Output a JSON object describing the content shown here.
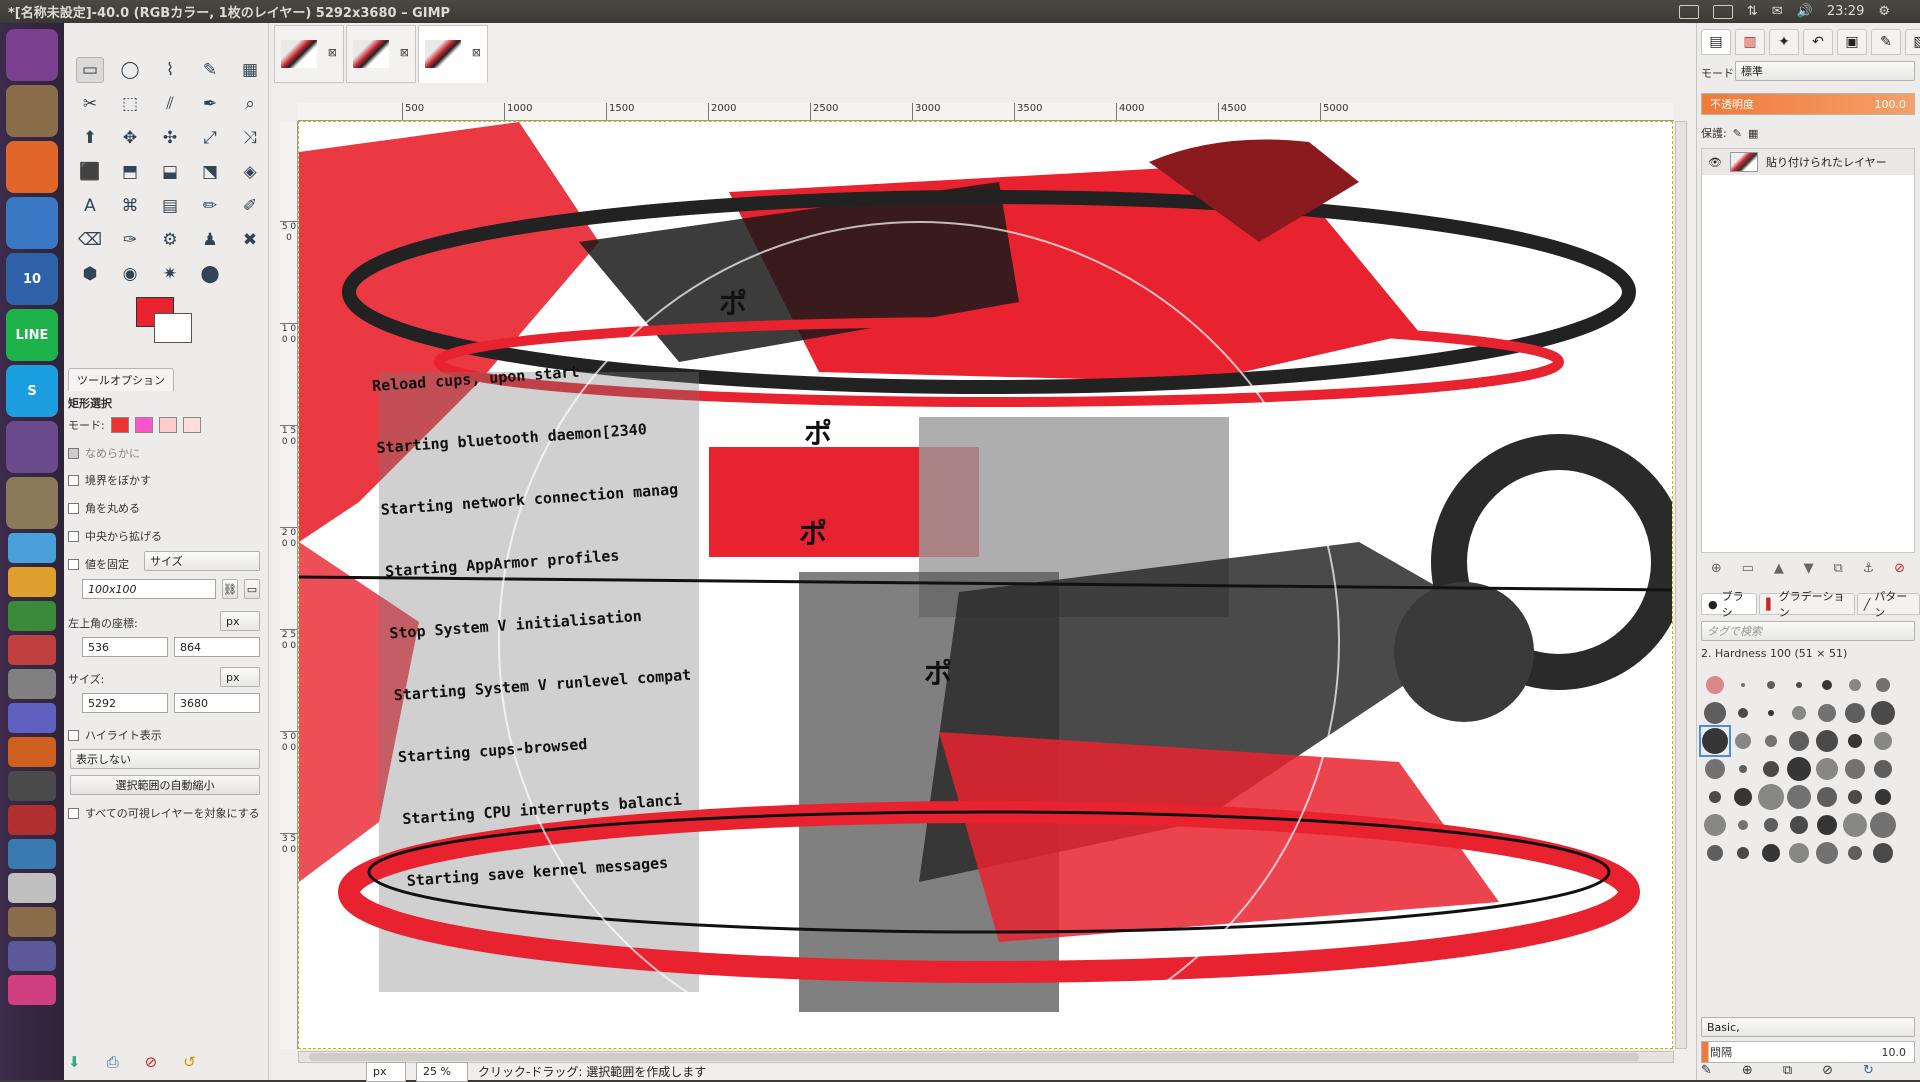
{
  "window": {
    "title": "*[名称未設定]-40.0 (RGBカラー, 1枚のレイヤー) 5292x3680 – GIMP",
    "clock": "23:29"
  },
  "launcher": {
    "items": [
      {
        "name": "ubuntu-dash-icon",
        "label": "",
        "color": "#7b3f8f"
      },
      {
        "name": "files-icon",
        "label": "",
        "color": "#8a6d4a"
      },
      {
        "name": "firefox-icon",
        "label": "",
        "color": "#e0662a"
      },
      {
        "name": "chromium-icon",
        "label": "",
        "color": "#3a78c4"
      },
      {
        "name": "thunderbird-icon",
        "label": "10",
        "color": "#2e62a8"
      },
      {
        "name": "line-icon",
        "label": "LINE",
        "color": "#1eb24a"
      },
      {
        "name": "skype-icon",
        "label": "S",
        "color": "#1a9ee0"
      },
      {
        "name": "screen-icon",
        "label": "",
        "color": "#6a4a8c"
      },
      {
        "name": "gimp-icon",
        "label": "",
        "color": "#8a7a5a"
      }
    ]
  },
  "toolbox": {
    "tools": [
      "▭",
      "◯",
      "⌇",
      "✎",
      "▦",
      "✂",
      "⬚",
      "⫽",
      "✒",
      "⌕",
      "⬆",
      "✥",
      "✣",
      "⤢",
      "⤨",
      "⬛",
      "⬒",
      "⬓",
      "⬔",
      "◈",
      "A",
      "⌘",
      "▤",
      "✏",
      "✐",
      "⌫",
      "✑",
      "⚙",
      "♟",
      "✖",
      "⬢",
      "◉",
      "✷",
      "⬤"
    ],
    "tool_options_tab": "ツールオプション",
    "tool_title": "矩形選択",
    "mode_label": "モード:",
    "antialias": "なめらかに",
    "feather": "境界をぼかす",
    "round_corners": "角を丸める",
    "expand_center": "中央から拡げる",
    "fixed": "値を固定",
    "fixed_mode": "サイズ",
    "fixed_value": "100x100",
    "position_label": "左上角の座標:",
    "position_unit": "px",
    "pos_x": "536",
    "pos_y": "864",
    "size_label": "サイズ:",
    "size_unit": "px",
    "size_w": "5292",
    "size_h": "3680",
    "highlight": "ハイライト表示",
    "guides": "表示しない",
    "auto_shrink": "選択範囲の自動縮小",
    "sample_merged": "すべての可視レイヤーを対象にする"
  },
  "canvas": {
    "ruler_ticks": [
      "500",
      "1000",
      "1500",
      "2000",
      "2500",
      "3000",
      "3500",
      "4000",
      "4500",
      "5000"
    ],
    "vruler_ticks": [
      "5 0 0",
      "1 0 0 0",
      "1 5 0 0",
      "2 0 0 0",
      "2 5 0 0",
      "3 0 0 0",
      "3 5 0 0"
    ],
    "terminal_lines": [
      "Reload cups, upon start",
      "Starting bluetooth daemon[2340",
      "Starting network connection manag",
      "Starting AppArmor profiles",
      "Stop System V initialisation",
      "Starting System V runlevel compat",
      "Starting cups-browsed",
      "Starting CPU interrupts balanci",
      "Starting save kernel messages"
    ],
    "onomatopoeia": "ポ",
    "unit": "px",
    "zoom": "25 %",
    "status": "クリック-ドラッグ: 選択範囲を作成します"
  },
  "dock": {
    "mode_label": "モード:",
    "mode_value": "標準",
    "opacity_label": "不透明度",
    "opacity_value": "100.0",
    "lock_label": "保護:",
    "layer_name": "貼り付けられたレイヤー",
    "brush_tab": "ブラシ",
    "gradient_tab": "グラデーション",
    "pattern_tab": "パターン",
    "tag_placeholder": "タグで検索",
    "brush_name": "2. Hardness 100 (51 × 51)",
    "preset": "Basic,",
    "spacing_label": "間隔",
    "spacing_value": "10.0"
  }
}
